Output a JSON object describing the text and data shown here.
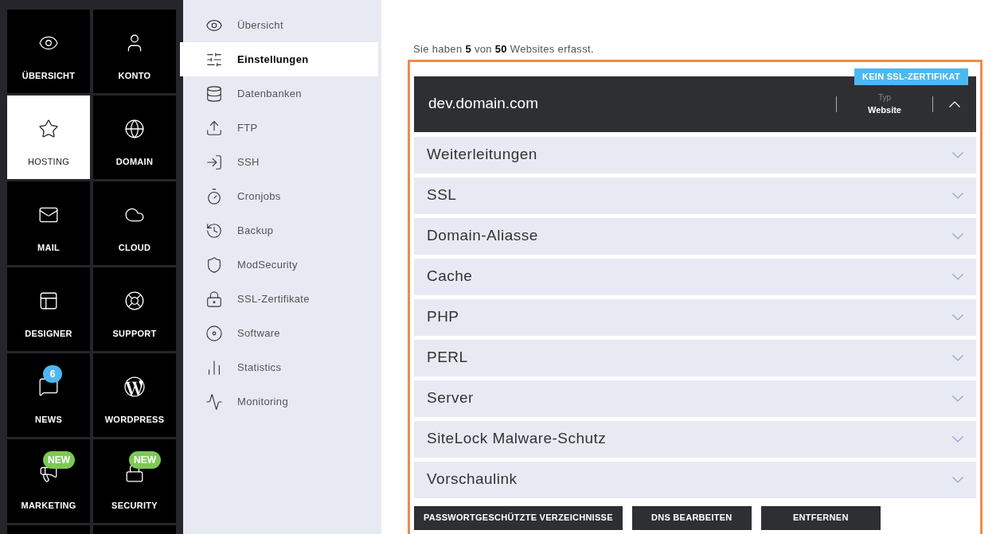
{
  "main_nav": [
    {
      "label": "ÜBERSICHT",
      "selected": false
    },
    {
      "label": "KONTO",
      "selected": false
    },
    {
      "label": "HOSTING",
      "selected": true
    },
    {
      "label": "DOMAIN",
      "selected": false
    },
    {
      "label": "MAIL",
      "selected": false
    },
    {
      "label": "CLOUD",
      "selected": false
    },
    {
      "label": "DESIGNER",
      "selected": false
    },
    {
      "label": "SUPPORT",
      "selected": false
    },
    {
      "label": "NEWS",
      "selected": false,
      "badge": {
        "text": "6",
        "color": "#4db8ef"
      }
    },
    {
      "label": "WORDPRESS",
      "selected": false
    },
    {
      "label": "MARKETING",
      "selected": false,
      "badge": {
        "text": "NEW",
        "color": "#7dc855"
      }
    },
    {
      "label": "SECURITY",
      "selected": false,
      "badge": {
        "text": "NEW",
        "color": "#7dc855"
      }
    }
  ],
  "sub_nav": [
    {
      "label": "Übersicht",
      "selected": false
    },
    {
      "label": "Einstellungen",
      "selected": true
    },
    {
      "label": "Datenbanken",
      "selected": false
    },
    {
      "label": "FTP",
      "selected": false
    },
    {
      "label": "SSH",
      "selected": false
    },
    {
      "label": "Cronjobs",
      "selected": false
    },
    {
      "label": "Backup",
      "selected": false
    },
    {
      "label": "ModSecurity",
      "selected": false
    },
    {
      "label": "SSL-Zertifikate",
      "selected": false
    },
    {
      "label": "Software",
      "selected": false
    },
    {
      "label": "Statistics",
      "selected": false
    },
    {
      "label": "Monitoring",
      "selected": false
    }
  ],
  "summary": "Sie haben **5** von **50** Websites erfasst.",
  "website": {
    "domain": "dev.domain.com",
    "ssl_badge": "KEIN SSL-ZERTIFIKAT",
    "type_label": "Typ",
    "type_value": "Website",
    "expanded": true
  },
  "sections": [
    {
      "label": "Weiterleitungen",
      "expanded": false
    },
    {
      "label": "SSL",
      "expanded": false
    },
    {
      "label": "Domain-Aliasse",
      "expanded": false
    },
    {
      "label": "Cache",
      "expanded": false
    },
    {
      "label": "PHP",
      "expanded": false
    },
    {
      "label": "PERL",
      "expanded": false
    },
    {
      "label": "Server",
      "expanded": false
    },
    {
      "label": "SiteLock Malware-Schutz",
      "expanded": false
    },
    {
      "label": "Vorschaulink",
      "expanded": false
    }
  ],
  "actions": [
    "PASSWORTGESCHÜTZTE VERZEICHNISSE",
    "DNS BEARBEITEN",
    "ENTFERNEN"
  ]
}
